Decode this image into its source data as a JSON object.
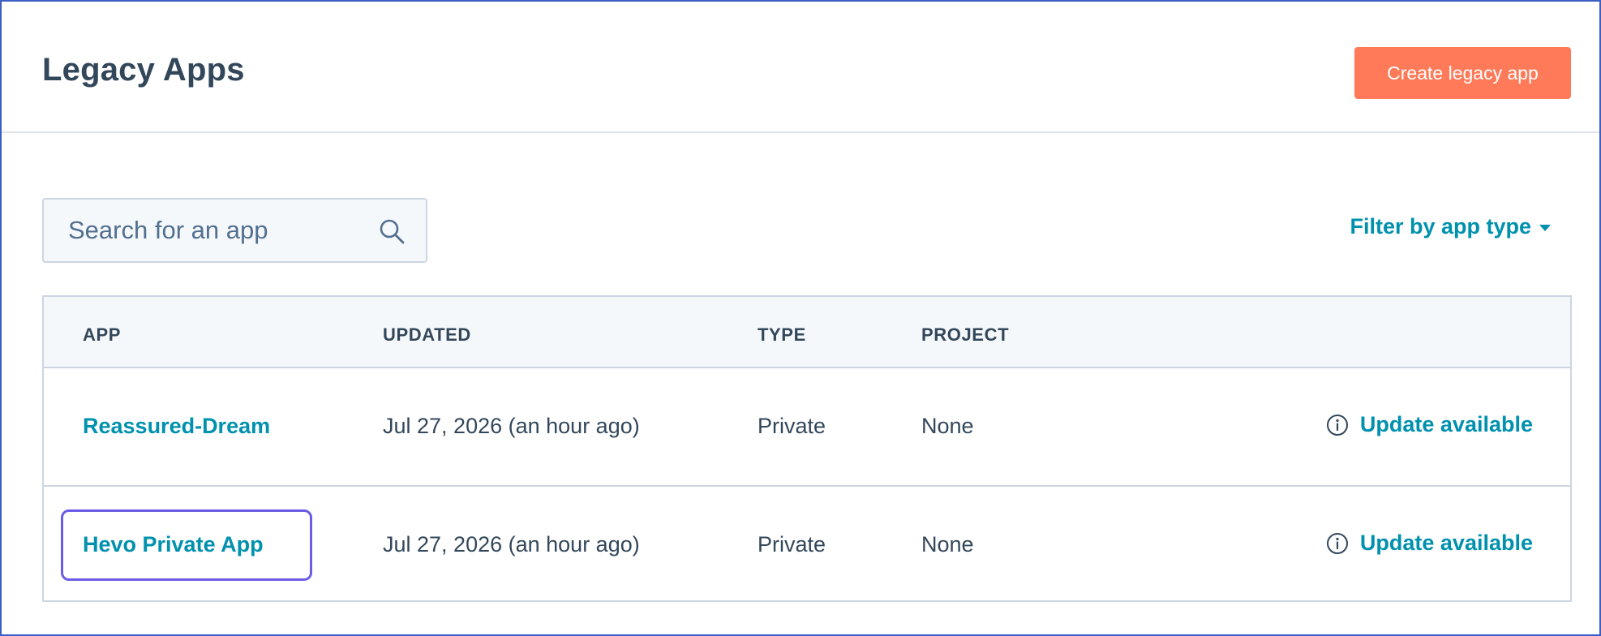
{
  "header": {
    "title": "Legacy Apps",
    "create_button_label": "Create legacy app"
  },
  "search": {
    "placeholder": "Search for an app",
    "icon": "search-icon"
  },
  "filter": {
    "label": "Filter by app type",
    "icon": "caret-down-icon"
  },
  "table": {
    "columns": [
      "APP",
      "UPDATED",
      "TYPE",
      "PROJECT"
    ],
    "rows": [
      {
        "app": "Reassured-Dream",
        "updated": "Jul 27, 2026 (an hour ago)",
        "type": "Private",
        "project": "None",
        "status": "Update available",
        "status_icon": "info-icon"
      },
      {
        "app": "Hevo Private App",
        "updated": "Jul 27, 2026 (an hour ago)",
        "type": "Private",
        "project": "None",
        "status": "Update available",
        "status_icon": "info-icon",
        "focused": true
      }
    ]
  },
  "colors": {
    "accent": "#0091ae",
    "primary_button": "#ff7a59",
    "text": "#33475b",
    "focus_ring": "#6b5ce7",
    "border": "#cbd6e2"
  }
}
